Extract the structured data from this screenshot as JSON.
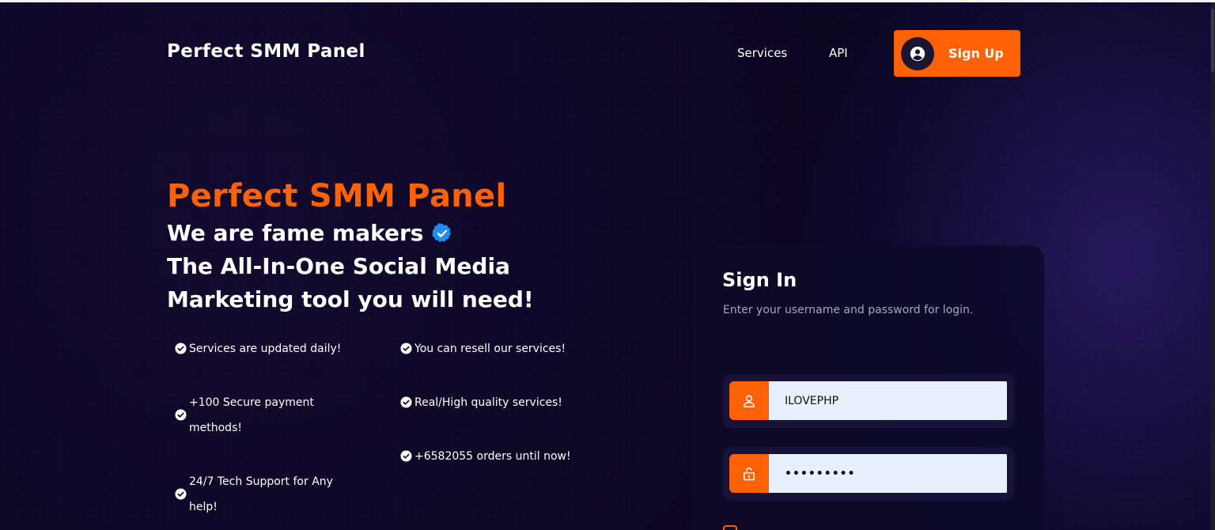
{
  "colors": {
    "accent": "#ff6107",
    "background": "#0b0622",
    "input_bg": "#e9f0fd",
    "verified": "#1d8ef0"
  },
  "nav": {
    "brand": "Perfect SMM Panel",
    "links": [
      "Services",
      "API"
    ],
    "signup_label": "Sign Up",
    "signup_icon": "user-circle-icon"
  },
  "hero": {
    "title": "Perfect SMM Panel",
    "line1": "We are fame makers",
    "line1_badge_icon": "verified-badge-icon",
    "line2": "The All-In-One Social Media",
    "line3": "Marketing tool you will need!",
    "features_left": [
      "Services are updated daily!",
      "+100 Secure payment methods!",
      "24/7 Tech Support for Any help!"
    ],
    "features_right": [
      "You can resell our services!",
      "Real/High quality services!",
      "+6582055 orders until now!"
    ]
  },
  "signin": {
    "title": "Sign In",
    "subtitle": "Enter your username and password for login.",
    "username_value": "ILOVEPHP",
    "password_value": "•••••••••",
    "username_icon": "user-icon",
    "password_icon": "lock-icon"
  }
}
